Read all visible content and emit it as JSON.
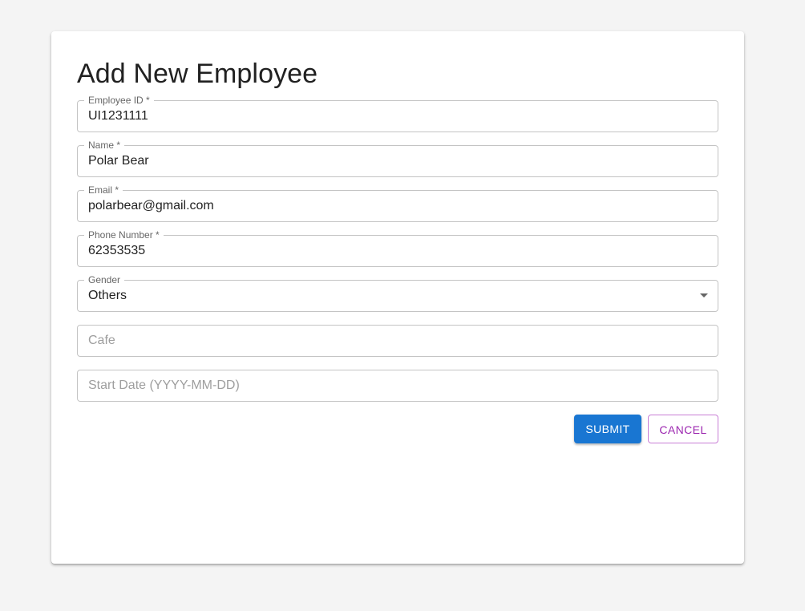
{
  "form": {
    "title": "Add New Employee",
    "fields": {
      "employee_id": {
        "label": "Employee ID *",
        "value": "UI1231111"
      },
      "name": {
        "label": "Name *",
        "value": "Polar Bear"
      },
      "email": {
        "label": "Email *",
        "value": "polarbear@gmail.com"
      },
      "phone": {
        "label": "Phone Number *",
        "value": "62353535"
      },
      "gender": {
        "label": "Gender",
        "value": "Others"
      },
      "cafe": {
        "placeholder": "Cafe"
      },
      "start_date": {
        "placeholder": "Start Date (YYYY-MM-DD)"
      }
    },
    "buttons": {
      "submit": "SUBMIT",
      "cancel": "CANCEL"
    }
  },
  "colors": {
    "primary": "#1976d2",
    "secondary": "#9c27b0"
  }
}
